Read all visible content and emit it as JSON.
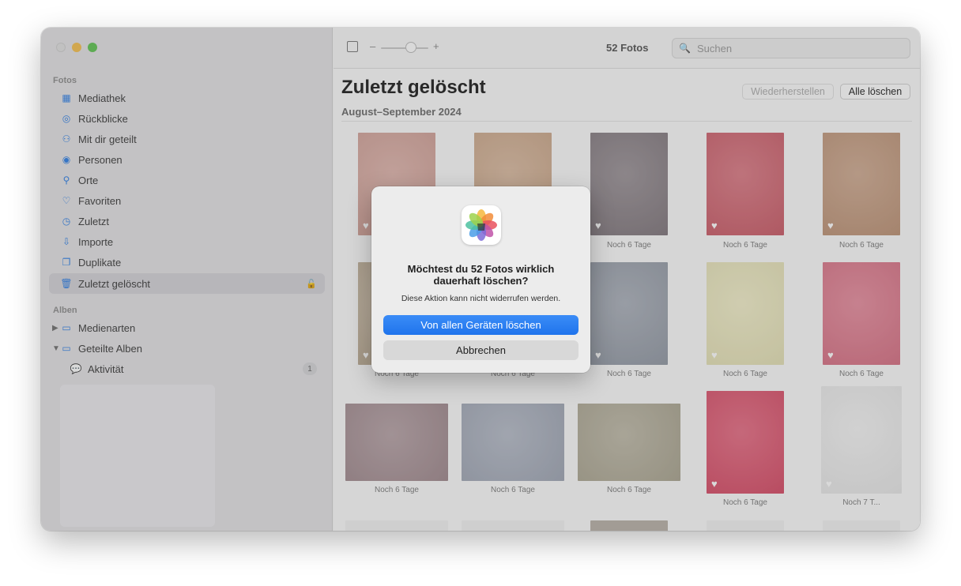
{
  "sidebar": {
    "section_fotos": "Fotos",
    "items": [
      {
        "label": "Mediathek",
        "icon": "library-icon"
      },
      {
        "label": "Rückblicke",
        "icon": "memories-icon"
      },
      {
        "label": "Mit dir geteilt",
        "icon": "shared-with-you-icon"
      },
      {
        "label": "Personen",
        "icon": "people-icon"
      },
      {
        "label": "Orte",
        "icon": "places-icon"
      },
      {
        "label": "Favoriten",
        "icon": "heart-icon"
      },
      {
        "label": "Zuletzt",
        "icon": "recents-icon"
      },
      {
        "label": "Importe",
        "icon": "import-icon"
      },
      {
        "label": "Duplikate",
        "icon": "duplicates-icon"
      },
      {
        "label": "Zuletzt gelöscht",
        "icon": "trash-icon",
        "selected": true
      }
    ],
    "section_alben": "Alben",
    "albums": [
      {
        "label": "Medienarten",
        "icon": "folder-icon"
      },
      {
        "label": "Geteilte Alben",
        "icon": "folder-icon"
      },
      {
        "label": "Aktivität",
        "icon": "activity-icon",
        "badge": "1"
      }
    ]
  },
  "toolbar": {
    "photo_count": "52 Fotos",
    "search_placeholder": "Suchen",
    "zoom_minus": "–",
    "zoom_plus": "+"
  },
  "main": {
    "title": "Zuletzt gelöscht",
    "date_range": "August–September 2024",
    "restore_label": "Wiederherstellen",
    "delete_all_label": "Alle löschen"
  },
  "photos": [
    {
      "label": "Noch 6 Tage",
      "color": "#d9a69c"
    },
    {
      "label": "Noch 6 Tage",
      "color": "#d3ad8e"
    },
    {
      "label": "Noch 6 Tage",
      "color": "#877d83"
    },
    {
      "label": "Noch 6 Tage",
      "color": "#d4606d"
    },
    {
      "label": "Noch 6 Tage",
      "color": "#c69a7c"
    },
    {
      "label": "Noch 6 Tage",
      "color": "#c4b39b"
    },
    {
      "label": "Noch 6 Tage",
      "color": "#c2b6ab"
    },
    {
      "label": "Noch 6 Tage",
      "color": "#9aa1ad"
    },
    {
      "label": "Noch 6 Tage",
      "color": "#f0ecbf"
    },
    {
      "label": "Noch 6 Tage",
      "color": "#e2768b"
    },
    {
      "label": "Noch 6 Tage",
      "color": "#a89095"
    },
    {
      "label": "Noch 6 Tage",
      "color": "#a7aebd"
    },
    {
      "label": "Noch 6 Tage",
      "color": "#b3ad98"
    },
    {
      "label": "Noch 6 Tage",
      "color": "#e14f6b"
    },
    {
      "label": "Noch 7 T...",
      "color": "#f3f3f3"
    }
  ],
  "dialog": {
    "title": "Möchtest du 52 Fotos wirklich dauerhaft löschen?",
    "message": "Diese Aktion kann nicht widerrufen werden.",
    "primary_label": "Von allen Geräten löschen",
    "secondary_label": "Abbrechen"
  }
}
